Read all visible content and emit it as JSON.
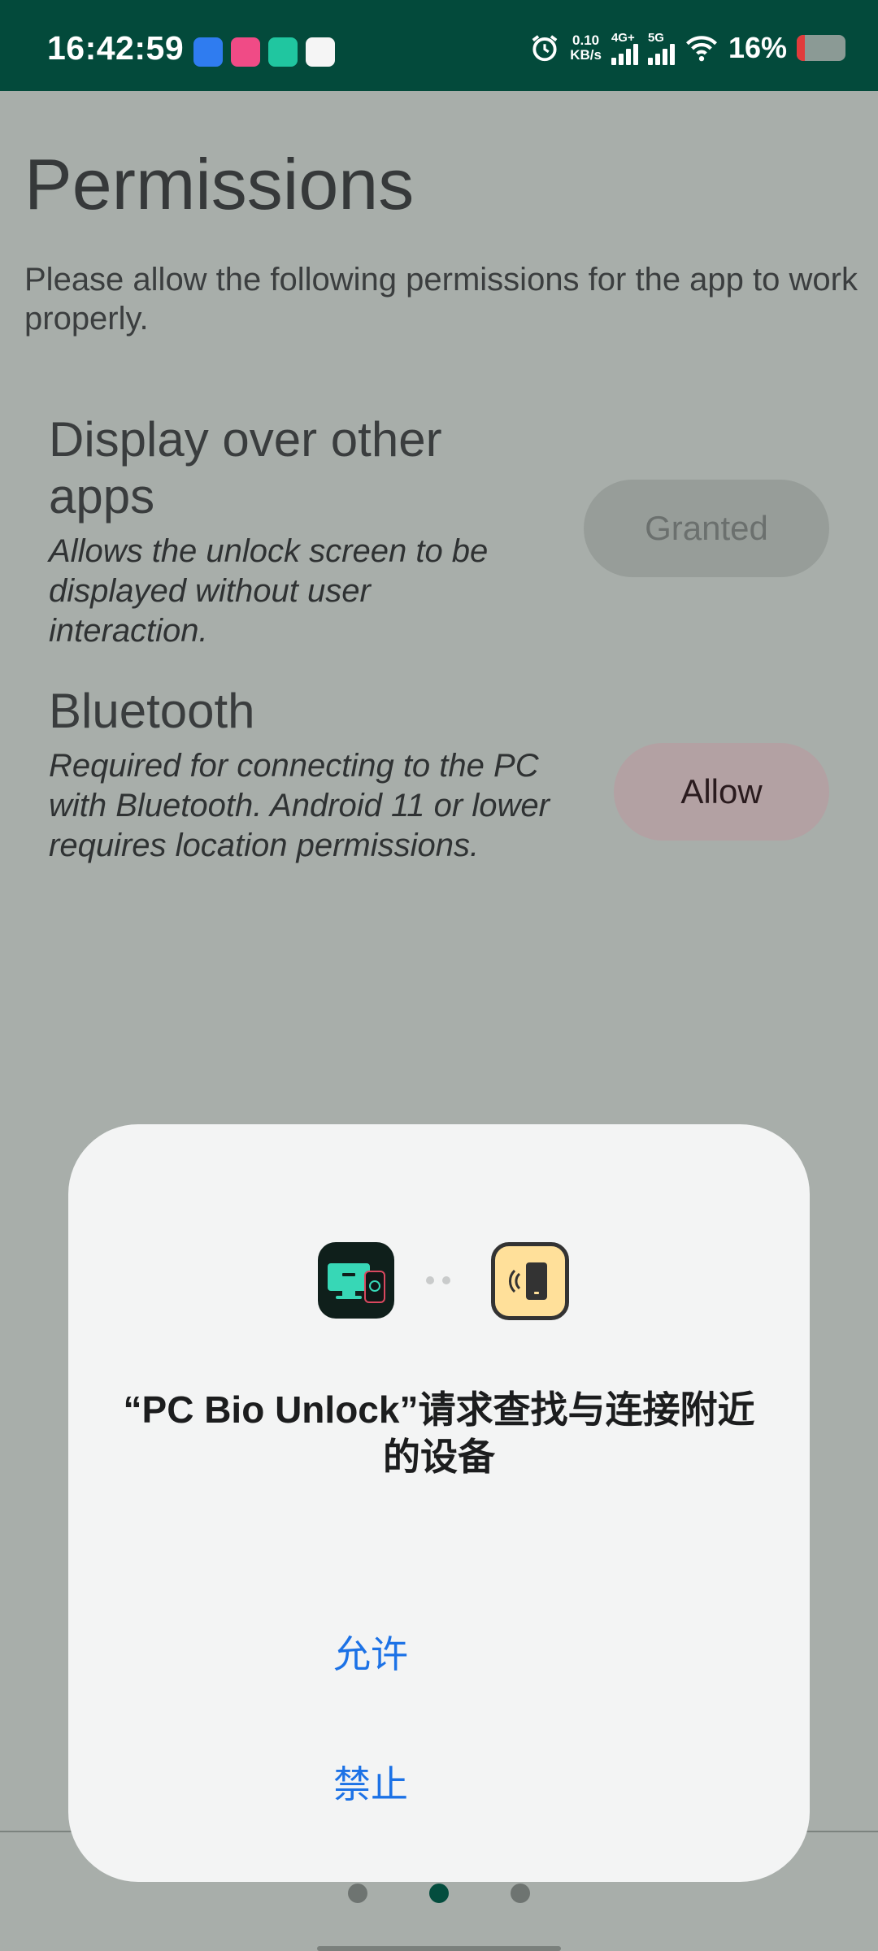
{
  "status_bar": {
    "time": "16:42:59",
    "net_speed_value": "0.10",
    "net_speed_unit": "KB/s",
    "network_1": "4G+",
    "network_2": "5G",
    "battery_percent": "16%",
    "battery_level": 0.16
  },
  "page": {
    "title": "Permissions",
    "intro": "Please allow the following permissions for the app to work properly.",
    "permissions": [
      {
        "title": "Display over other apps",
        "description": "Allows the unlock screen to be displayed without user interaction.",
        "button_label": "Granted"
      },
      {
        "title": "Bluetooth",
        "description": "Required for connecting to the PC with Bluetooth. Android 11 or lower requires location permissions.",
        "button_label": "Allow"
      }
    ],
    "page_indicator": {
      "count": 3,
      "active": 2
    }
  },
  "dialog": {
    "message": "“PC Bio Unlock”请求查找与连接附近的设备",
    "allow_label": "允许",
    "deny_label": "禁止"
  },
  "colors": {
    "status_bar": "#034a3b",
    "scrim_background": "#a8aeaa",
    "dialog_background": "#f3f4f4",
    "dialog_button_text": "#1c72e6",
    "granted_pill": "#979d99",
    "allow_pill": "#b3a1a3",
    "active_dot": "#044d3e"
  }
}
